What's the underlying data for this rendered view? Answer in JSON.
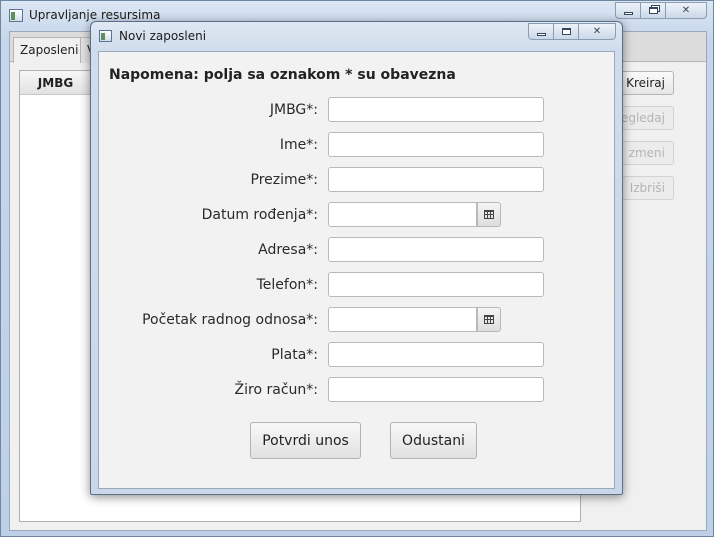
{
  "main_window": {
    "title": "Upravljanje resursima",
    "tabs": [
      {
        "label": "Zaposleni"
      },
      {
        "label": "V"
      }
    ],
    "table": {
      "column_header": "JMBG"
    },
    "side_buttons": [
      {
        "label": "Kreiraj",
        "enabled": true
      },
      {
        "label": "regledaj",
        "enabled": false
      },
      {
        "label": "zmeni",
        "enabled": false
      },
      {
        "label": "Izbriši",
        "enabled": false
      }
    ]
  },
  "dialog": {
    "title": "Novi zaposleni",
    "note": "Napomena: polja sa oznakom * su obavezna",
    "fields": [
      {
        "label": "JMBG*:",
        "value": "",
        "type": "text"
      },
      {
        "label": "Ime*:",
        "value": "",
        "type": "text"
      },
      {
        "label": "Prezime*:",
        "value": "",
        "type": "text"
      },
      {
        "label": "Datum rođenja*:",
        "value": "",
        "type": "date"
      },
      {
        "label": "Adresa*:",
        "value": "",
        "type": "text"
      },
      {
        "label": "Telefon*:",
        "value": "",
        "type": "text"
      },
      {
        "label": "Početak radnog odnosa*:",
        "value": "",
        "type": "date"
      },
      {
        "label": "Plata*:",
        "value": "",
        "type": "text"
      },
      {
        "label": "Žiro račun*:",
        "value": "",
        "type": "text"
      }
    ],
    "confirm_label": "Potvrdi unos",
    "cancel_label": "Odustani"
  },
  "icons": {
    "app": "window-app-icon",
    "minimize": "minimize-icon",
    "maximize": "maximize-icon",
    "close": "close-icon",
    "calendar": "calendar-icon"
  }
}
